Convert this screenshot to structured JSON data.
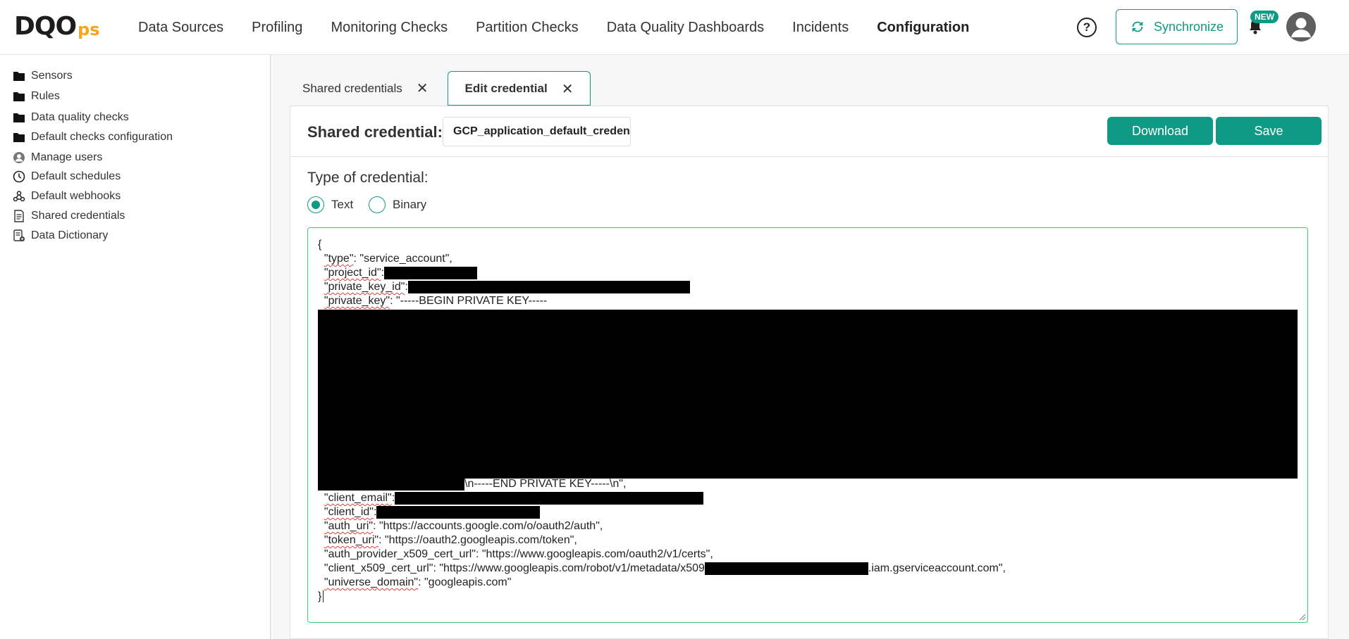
{
  "header": {
    "logo_main": "DQO",
    "logo_suffix": "ps",
    "nav": [
      "Data Sources",
      "Profiling",
      "Monitoring Checks",
      "Partition Checks",
      "Data Quality Dashboards",
      "Incidents",
      "Configuration"
    ],
    "active_nav": "Configuration",
    "sync_label": "Synchronize",
    "new_badge": "NEW",
    "help_glyph": "?"
  },
  "sidebar": {
    "items": [
      {
        "label": "Sensors",
        "icon": "folder-icon"
      },
      {
        "label": "Rules",
        "icon": "folder-icon"
      },
      {
        "label": "Data quality checks",
        "icon": "folder-icon"
      },
      {
        "label": "Default checks configuration",
        "icon": "folder-icon"
      },
      {
        "label": "Manage users",
        "icon": "user-circle-icon"
      },
      {
        "label": "Default schedules",
        "icon": "clock-icon"
      },
      {
        "label": "Default webhooks",
        "icon": "webhook-icon"
      },
      {
        "label": "Shared credentials",
        "icon": "document-icon"
      },
      {
        "label": "Data Dictionary",
        "icon": "dictionary-icon"
      }
    ]
  },
  "tabs": [
    {
      "label": "Shared credentials",
      "close": "✕"
    },
    {
      "label": "Edit credential",
      "close": "✕"
    }
  ],
  "panel": {
    "label": "Shared credential:",
    "name_value": "GCP_application_default_credentials",
    "download_label": "Download",
    "save_label": "Save",
    "type_label": "Type of credential:",
    "radio_text": "Text",
    "radio_binary": "Binary",
    "selected_type": "Text"
  },
  "editor": {
    "lines": {
      "open": "{",
      "type_key": "\"type\"",
      "type_val": ": \"service_account\",",
      "project_key": "\"project_id\"",
      "project_val": ":",
      "pkid_key": "\"private_key_id\"",
      "pkid_val": ":",
      "pk_key": "\"private_key\"",
      "pk_val": ": \"-----BEGIN PRIVATE KEY-----",
      "end_key": "\\n-----END PRIVATE KEY-----\\n\",",
      "email_key": "\"client_email\"",
      "email_val": ":",
      "cid_key": "\"client_id\"",
      "cid_val": ":",
      "auth_key": "\"auth_uri\"",
      "auth_val": ": \"https://accounts.google.com/o/oauth2/auth\",",
      "token_key": "\"token_uri\"",
      "token_val": ": \"https://oauth2.googleapis.com/token\",",
      "provider_line": "\"auth_provider_x509_cert_url\": \"https://www.googleapis.com/oauth2/v1/certs\",",
      "certurl_pre": "\"client_x509_cert_url\": \"https://www.googleapis.com/robot/v1/metadata/x509",
      "certurl_post": ".iam.gserviceaccount.com\",",
      "universe_key": "\"universe_domain\"",
      "universe_val": ": \"googleapis.com\"",
      "close": "}"
    }
  },
  "colors": {
    "accent": "#0e9a84",
    "logo_orange": "#f7a31c",
    "editor_border": "#3ccf74"
  }
}
